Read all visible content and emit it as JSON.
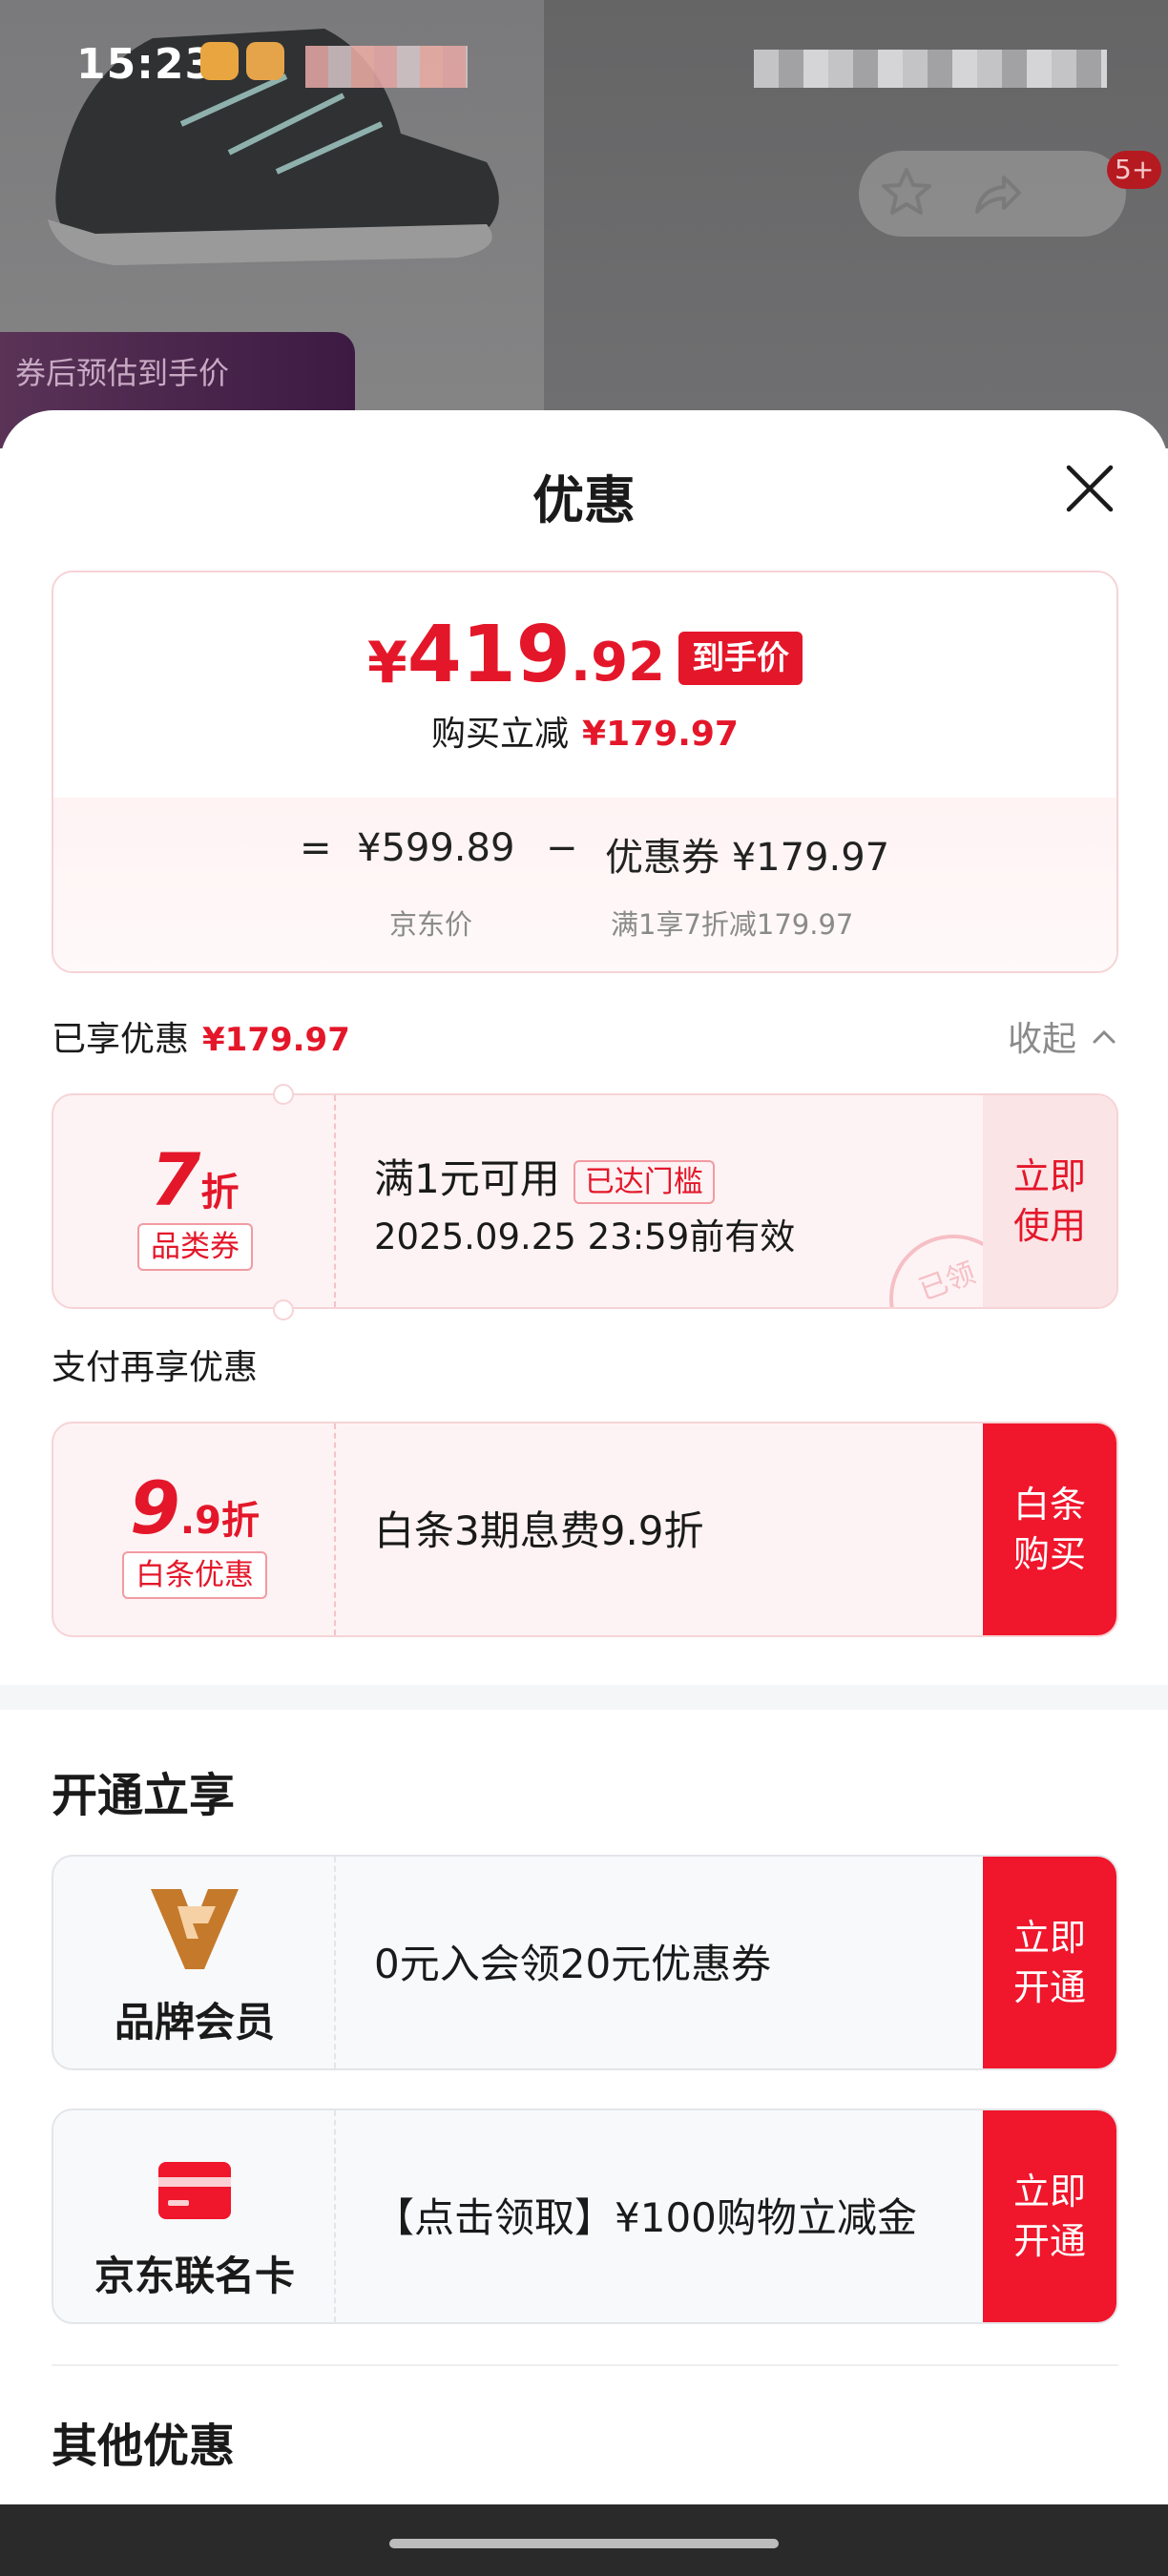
{
  "status_bar": {
    "time": "15:23"
  },
  "background": {
    "badge": "5+",
    "promo_tag": "券后预估到手价"
  },
  "sheet": {
    "title": "优惠",
    "price": {
      "currency": "¥",
      "integer": "419",
      "decimal": ".92",
      "final_tag": "到手价",
      "instant_label": "购买立减",
      "instant_amount": "¥179.97",
      "eq": "=",
      "original": "¥599.89",
      "minus": "−",
      "coupon_label": "优惠券 ¥179.97",
      "original_caption": "京东价",
      "coupon_caption": "满1享7折减179.97"
    },
    "enjoyed": {
      "label": "已享优惠",
      "amount": "¥179.97",
      "collapse": "收起"
    },
    "coupon1": {
      "value": "7",
      "unit": "折",
      "chip": "品类券",
      "condition": "满1元可用",
      "threshold_tag": "已达门槛",
      "validity": "2025.09.25 23:59前有效",
      "action": "立即使用",
      "stamp": "已领"
    },
    "pay_section_label": "支付再享优惠",
    "coupon2": {
      "value": "9",
      "unit": ".9折",
      "chip": "白条优惠",
      "desc": "白条3期息费9.9折",
      "action": "白条购买"
    },
    "open_section_title": "开通立享",
    "member1": {
      "name": "品牌会员",
      "desc": "0元入会领20元优惠券",
      "action": "立即开通"
    },
    "member2": {
      "name": "京东联名卡",
      "desc": "【点击领取】¥100购物立减金",
      "action": "立即开通"
    },
    "other_section_title": "其他优惠"
  },
  "colors": {
    "accent_red": "#e4172a",
    "action_red": "#f0162c",
    "brand_gold": "#c57a2b"
  },
  "icons": [
    "close-icon",
    "chevron-up-icon",
    "brand-member-logo",
    "credit-card-icon",
    "star-icon",
    "share-icon"
  ]
}
